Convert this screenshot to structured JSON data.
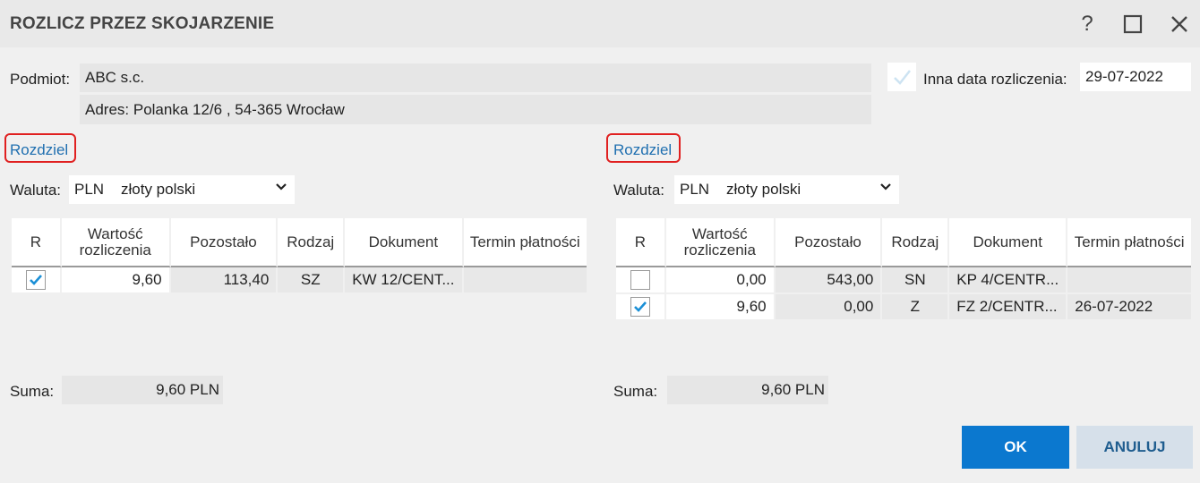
{
  "window": {
    "title": "ROZLICZ PRZEZ SKOJARZENIE"
  },
  "titlebar": {
    "help": "?",
    "maximize": "☐",
    "close": "✕"
  },
  "header": {
    "podmiot_label": "Podmiot:",
    "podmiot_value": "ABC s.c.",
    "adres_value": "Adres:  Polanka  12/6 , 54-365 Wrocław",
    "inna_data_label": "Inna data rozliczenia:",
    "inna_data_checked": false,
    "inna_data_value": "29-07-2022"
  },
  "left": {
    "rozdziel": "Rozdziel",
    "waluta_label": "Waluta:",
    "currency_code": "PLN",
    "currency_name": "złoty polski",
    "columns": [
      "R",
      "Wartość rozliczenia",
      "Pozostało",
      "Rodzaj",
      "Dokument",
      "Termin płatności"
    ],
    "rows": [
      {
        "checked": true,
        "wartosc": "9,60",
        "pozostalo": "113,40",
        "rodzaj": "SZ",
        "dokument": "KW 12/CENT...",
        "termin": ""
      }
    ],
    "suma_label": "Suma:",
    "suma_value": "9,60 PLN"
  },
  "right": {
    "rozdziel": "Rozdziel",
    "waluta_label": "Waluta:",
    "currency_code": "PLN",
    "currency_name": "złoty polski",
    "columns": [
      "R",
      "Wartość rozliczenia",
      "Pozostało",
      "Rodzaj",
      "Dokument",
      "Termin płatności"
    ],
    "rows": [
      {
        "checked": false,
        "wartosc": "0,00",
        "pozostalo": "543,00",
        "rodzaj": "SN",
        "dokument": "KP 4/CENTR...",
        "termin": ""
      },
      {
        "checked": true,
        "wartosc": "9,60",
        "pozostalo": "0,00",
        "rodzaj": "Z",
        "dokument": "FZ 2/CENTR...",
        "termin": "26-07-2022"
      }
    ],
    "suma_label": "Suma:",
    "suma_value": "9,60 PLN"
  },
  "buttons": {
    "ok": "OK",
    "cancel": "ANULUJ"
  },
  "colors": {
    "accent": "#0b78cf",
    "link": "#1f6fb0",
    "highlight": "#e02020",
    "check": "#1a8fd6"
  }
}
